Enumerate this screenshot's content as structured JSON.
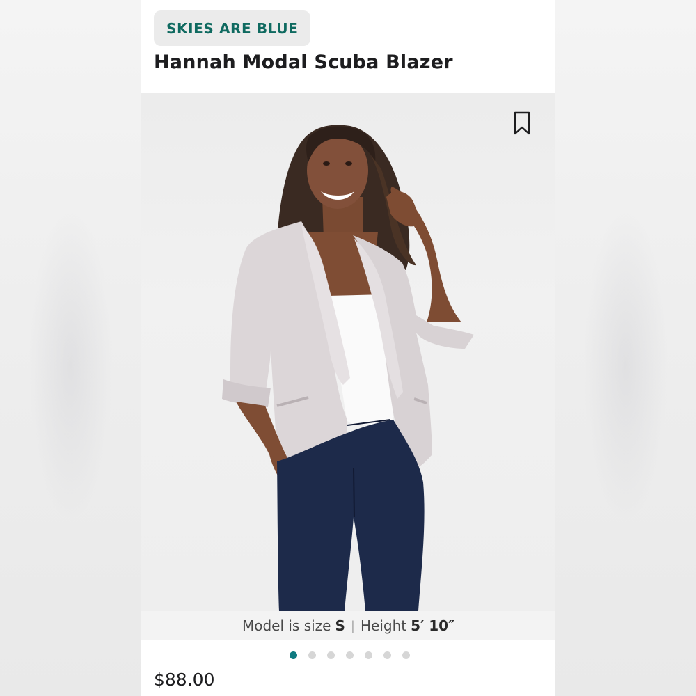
{
  "product": {
    "brand": "SKIES ARE BLUE",
    "title": "Hannah Modal Scuba Blazer",
    "price": "$88.00"
  },
  "gallery": {
    "image_count": 7,
    "active_index": 0,
    "model_size_prefix": "Model is size",
    "model_size": "S",
    "separator": "|",
    "height_prefix": "Height",
    "height_value": "5′ 10″"
  },
  "colors": {
    "brand_text": "#0f6a60",
    "active_dot": "#0f7a80",
    "inactive_dot": "#d6d6d6"
  },
  "icons": {
    "bookmark": "bookmark-icon"
  }
}
